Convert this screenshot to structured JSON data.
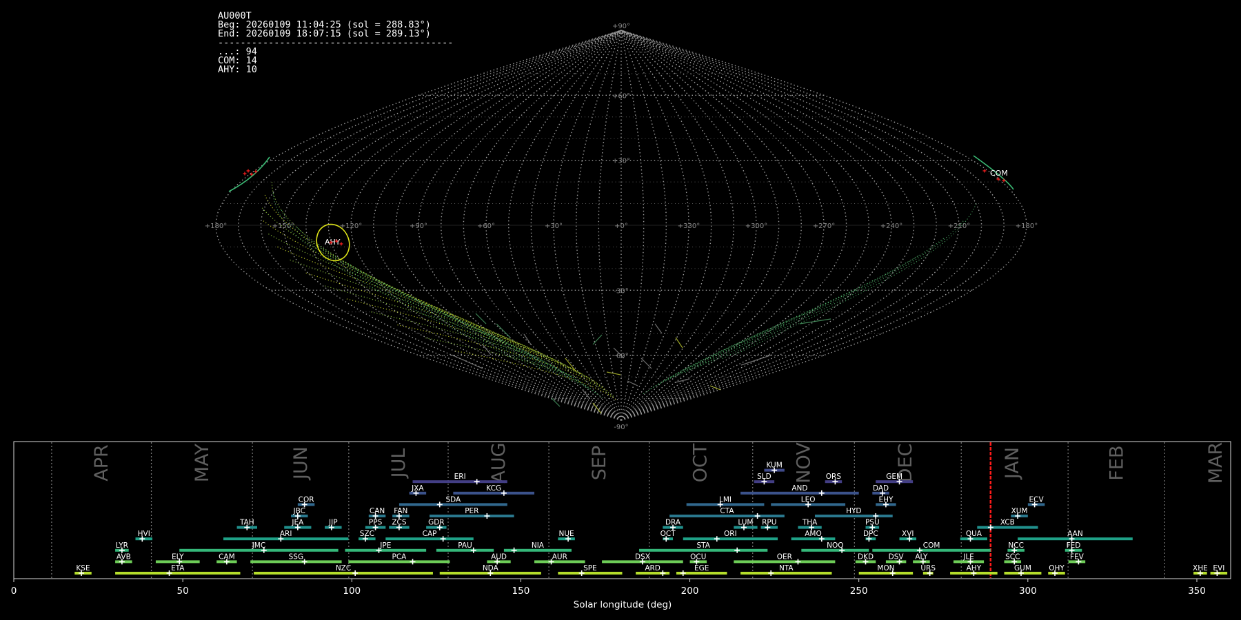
{
  "info": {
    "station": "AU000T",
    "beg": "Beg: 20260109 11:04:25 (sol = 288.83°)",
    "end": "End: 20260109 18:07:15 (sol = 289.13°)",
    "separator": "------------------------------------------",
    "counts": [
      "...: 94",
      "COM: 14",
      "AHY: 10"
    ]
  },
  "sky": {
    "lat_labels": [
      "+90°",
      "+60°",
      "+30°",
      "-30°",
      "-60°",
      "-90°"
    ],
    "lon_labels": [
      "+180°",
      "+150°",
      "+120°",
      "+90°",
      "+60°",
      "+30°",
      "+0°",
      "+330°",
      "+300°",
      "+270°",
      "+240°",
      "+210°",
      "+180°"
    ],
    "radiants": [
      {
        "code": "AHY",
        "color": "#dde318"
      },
      {
        "code": "COM",
        "color": "#3bbb75"
      }
    ]
  },
  "chart_data": {
    "type": "bar",
    "xlabel": "Solar longitude (deg)",
    "xlim": [
      0,
      360
    ],
    "xticks": [
      0,
      50,
      100,
      150,
      200,
      250,
      300,
      350
    ],
    "current_sol": 288.98,
    "months": [
      {
        "label": "APR",
        "start": 11.2
      },
      {
        "label": "MAY",
        "start": 40.7
      },
      {
        "label": "JUN",
        "start": 70.6
      },
      {
        "label": "JUL",
        "start": 99.1
      },
      {
        "label": "AUG",
        "start": 128.5
      },
      {
        "label": "SEP",
        "start": 158.3
      },
      {
        "label": "OCT",
        "start": 188.0
      },
      {
        "label": "NOV",
        "start": 218.6
      },
      {
        "label": "DEC",
        "start": 248.7
      },
      {
        "label": "JAN",
        "start": 280.3
      },
      {
        "label": "FEB",
        "start": 311.9
      },
      {
        "label": "MAR",
        "start": 340.5
      }
    ],
    "showers": [
      {
        "code": "KUM",
        "start": 222,
        "end": 228,
        "peak": 225,
        "row": 8,
        "color": "#3f4a8a"
      },
      {
        "code": "ERI",
        "start": 118,
        "end": 146,
        "peak": 137,
        "row": 7,
        "color": "#433e85"
      },
      {
        "code": "SLD",
        "start": 219,
        "end": 225,
        "peak": 222,
        "row": 7,
        "color": "#433e85"
      },
      {
        "code": "ORS",
        "start": 240,
        "end": 245,
        "peak": 243,
        "row": 7,
        "color": "#433e85"
      },
      {
        "code": "GEM",
        "start": 255,
        "end": 266,
        "peak": 262,
        "row": 7,
        "color": "#433e85"
      },
      {
        "code": "JXA",
        "start": 117,
        "end": 122,
        "peak": 119,
        "row": 6,
        "color": "#3b528b"
      },
      {
        "code": "KCG",
        "start": 130,
        "end": 154,
        "peak": 145,
        "row": 6,
        "color": "#3b528b"
      },
      {
        "code": "AND",
        "start": 215,
        "end": 250,
        "peak": 239,
        "row": 6,
        "color": "#3b528b"
      },
      {
        "code": "DAD",
        "start": 254,
        "end": 259,
        "peak": 257,
        "row": 6,
        "color": "#3b528b"
      },
      {
        "code": "COR",
        "start": 84,
        "end": 89,
        "peak": 86,
        "row": 5,
        "color": "#31688e"
      },
      {
        "code": "SDA",
        "start": 114,
        "end": 146,
        "peak": 126,
        "row": 5,
        "color": "#31688e"
      },
      {
        "code": "LMI",
        "start": 199,
        "end": 222,
        "peak": 209,
        "row": 5,
        "color": "#31688e"
      },
      {
        "code": "LEO",
        "start": 224,
        "end": 246,
        "peak": 235,
        "row": 5,
        "color": "#31688e"
      },
      {
        "code": "EHY",
        "start": 255,
        "end": 261,
        "peak": 258,
        "row": 5,
        "color": "#31688e"
      },
      {
        "code": "ECV",
        "start": 300,
        "end": 305,
        "peak": 302,
        "row": 5,
        "color": "#31688e"
      },
      {
        "code": "JBC",
        "start": 82,
        "end": 87,
        "peak": 84,
        "row": 4,
        "color": "#2a788e"
      },
      {
        "code": "CAN",
        "start": 105,
        "end": 110,
        "peak": 107,
        "row": 4,
        "color": "#2a788e"
      },
      {
        "code": "FAN",
        "start": 112,
        "end": 117,
        "peak": 114,
        "row": 4,
        "color": "#2a788e"
      },
      {
        "code": "PER",
        "start": 123,
        "end": 148,
        "peak": 140,
        "row": 4,
        "color": "#2a788e"
      },
      {
        "code": "CTA",
        "start": 194,
        "end": 228,
        "peak": 220,
        "row": 4,
        "color": "#2a788e"
      },
      {
        "code": "HYD",
        "start": 237,
        "end": 260,
        "peak": 255,
        "row": 4,
        "color": "#2a788e"
      },
      {
        "code": "XUM",
        "start": 295,
        "end": 300,
        "peak": 297,
        "row": 4,
        "color": "#2a788e"
      },
      {
        "code": "TAH",
        "start": 66,
        "end": 72,
        "peak": 69,
        "row": 3,
        "color": "#21908d"
      },
      {
        "code": "JEA",
        "start": 80,
        "end": 88,
        "peak": 84,
        "row": 3,
        "color": "#21908d"
      },
      {
        "code": "JIP",
        "start": 92,
        "end": 97,
        "peak": 94,
        "row": 3,
        "color": "#21908d"
      },
      {
        "code": "PPS",
        "start": 104,
        "end": 110,
        "peak": 107,
        "row": 3,
        "color": "#21908d"
      },
      {
        "code": "ZCS",
        "start": 111,
        "end": 117,
        "peak": 114,
        "row": 3,
        "color": "#21908d"
      },
      {
        "code": "GDR",
        "start": 122,
        "end": 128,
        "peak": 126,
        "row": 3,
        "color": "#21908d"
      },
      {
        "code": "DRA",
        "start": 192,
        "end": 198,
        "peak": 195,
        "row": 3,
        "color": "#21908d"
      },
      {
        "code": "LUM",
        "start": 213,
        "end": 220,
        "peak": 216,
        "row": 3,
        "color": "#21908d"
      },
      {
        "code": "RPU",
        "start": 221,
        "end": 226,
        "peak": 223,
        "row": 3,
        "color": "#21908d"
      },
      {
        "code": "THA",
        "start": 232,
        "end": 239,
        "peak": 236,
        "row": 3,
        "color": "#21908d"
      },
      {
        "code": "PSU",
        "start": 252,
        "end": 256,
        "peak": 254,
        "row": 3,
        "color": "#21908d"
      },
      {
        "code": "XCB",
        "start": 285,
        "end": 303,
        "peak": 289,
        "row": 3,
        "color": "#21908d"
      },
      {
        "code": "HVI",
        "start": 36,
        "end": 41,
        "peak": 38,
        "row": 2,
        "color": "#1fa187"
      },
      {
        "code": "ARI",
        "start": 62,
        "end": 99,
        "peak": 79,
        "row": 2,
        "color": "#1fa187"
      },
      {
        "code": "SZC",
        "start": 102,
        "end": 107,
        "peak": 104,
        "row": 2,
        "color": "#1fa187"
      },
      {
        "code": "CAP",
        "start": 110,
        "end": 136,
        "peak": 127,
        "row": 2,
        "color": "#1fa187"
      },
      {
        "code": "NUE",
        "start": 161,
        "end": 166,
        "peak": 164,
        "row": 2,
        "color": "#1fa187"
      },
      {
        "code": "OCT",
        "start": 192,
        "end": 195,
        "peak": 193,
        "row": 2,
        "color": "#1fa187"
      },
      {
        "code": "ORI",
        "start": 198,
        "end": 226,
        "peak": 208,
        "row": 2,
        "color": "#1fa187"
      },
      {
        "code": "AMO",
        "start": 230,
        "end": 243,
        "peak": 239,
        "row": 2,
        "color": "#1fa187"
      },
      {
        "code": "DPC",
        "start": 252,
        "end": 255,
        "peak": 253,
        "row": 2,
        "color": "#1fa187"
      },
      {
        "code": "XVI",
        "start": 262,
        "end": 267,
        "peak": 265,
        "row": 2,
        "color": "#1fa187"
      },
      {
        "code": "QUA",
        "start": 280,
        "end": 288,
        "peak": 283,
        "row": 2,
        "color": "#1fa187"
      },
      {
        "code": "AAN",
        "start": 297,
        "end": 331,
        "peak": 313,
        "row": 2,
        "color": "#1fa187"
      },
      {
        "code": "LYR",
        "start": 30,
        "end": 34,
        "peak": 32,
        "row": 1,
        "color": "#35b779"
      },
      {
        "code": "JMC",
        "start": 49,
        "end": 96,
        "peak": 74,
        "row": 1,
        "color": "#35b779"
      },
      {
        "code": "JPE",
        "start": 98,
        "end": 122,
        "peak": 108,
        "row": 1,
        "color": "#35b779"
      },
      {
        "code": "PAU",
        "start": 125,
        "end": 142,
        "peak": 136,
        "row": 1,
        "color": "#35b779"
      },
      {
        "code": "NIA",
        "start": 145,
        "end": 165,
        "peak": 148,
        "row": 1,
        "color": "#35b779"
      },
      {
        "code": "STA",
        "start": 185,
        "end": 223,
        "peak": 214,
        "row": 1,
        "color": "#35b779"
      },
      {
        "code": "NOO",
        "start": 233,
        "end": 253,
        "peak": 245,
        "row": 1,
        "color": "#35b779"
      },
      {
        "code": "COM",
        "start": 254,
        "end": 289,
        "peak": 268,
        "row": 1,
        "color": "#35b779"
      },
      {
        "code": "NCC",
        "start": 294,
        "end": 299,
        "peak": 296,
        "row": 1,
        "color": "#35b779"
      },
      {
        "code": "FED",
        "start": 311,
        "end": 316,
        "peak": 313,
        "row": 1,
        "color": "#35b779"
      },
      {
        "code": "AVB",
        "start": 30,
        "end": 35,
        "peak": 32,
        "row": 0,
        "color": "#6ece58"
      },
      {
        "code": "ELY",
        "start": 42,
        "end": 55,
        "peak": 49,
        "row": 0,
        "color": "#6ece58"
      },
      {
        "code": "CAM",
        "start": 60,
        "end": 66,
        "peak": 63,
        "row": 0,
        "color": "#6ece58"
      },
      {
        "code": "SSG",
        "start": 70,
        "end": 97,
        "peak": 86,
        "row": 0,
        "color": "#6ece58"
      },
      {
        "code": "PCA",
        "start": 99,
        "end": 129,
        "peak": 118,
        "row": 0,
        "color": "#6ece58"
      },
      {
        "code": "AUD",
        "start": 140,
        "end": 147,
        "peak": 143,
        "row": 0,
        "color": "#6ece58"
      },
      {
        "code": "AUR",
        "start": 154,
        "end": 169,
        "peak": 159,
        "row": 0,
        "color": "#6ece58"
      },
      {
        "code": "DSX",
        "start": 174,
        "end": 198,
        "peak": 186,
        "row": 0,
        "color": "#6ece58"
      },
      {
        "code": "OCU",
        "start": 200,
        "end": 205,
        "peak": 202,
        "row": 0,
        "color": "#6ece58"
      },
      {
        "code": "OER",
        "start": 213,
        "end": 243,
        "peak": 232,
        "row": 0,
        "color": "#6ece58"
      },
      {
        "code": "DKD",
        "start": 249,
        "end": 255,
        "peak": 252,
        "row": 0,
        "color": "#6ece58"
      },
      {
        "code": "DSV",
        "start": 258,
        "end": 264,
        "peak": 262,
        "row": 0,
        "color": "#6ece58"
      },
      {
        "code": "ALY",
        "start": 266,
        "end": 271,
        "peak": 269,
        "row": 0,
        "color": "#6ece58"
      },
      {
        "code": "JLE",
        "start": 278,
        "end": 287,
        "peak": 283,
        "row": 0,
        "color": "#6ece58"
      },
      {
        "code": "SCC",
        "start": 293,
        "end": 298,
        "peak": 296,
        "row": 0,
        "color": "#6ece58"
      },
      {
        "code": "FEV",
        "start": 312,
        "end": 317,
        "peak": 315,
        "row": 0,
        "color": "#6ece58"
      },
      {
        "code": "KSE",
        "start": 18,
        "end": 23,
        "peak": 20,
        "row": -1,
        "color": "#b5de2b"
      },
      {
        "code": "ETA",
        "start": 30,
        "end": 67,
        "peak": 46,
        "row": -1,
        "color": "#b5de2b"
      },
      {
        "code": "NZC",
        "start": 71,
        "end": 124,
        "peak": 101,
        "row": -1,
        "color": "#b5de2b"
      },
      {
        "code": "NDA",
        "start": 126,
        "end": 156,
        "peak": 141,
        "row": -1,
        "color": "#b5de2b"
      },
      {
        "code": "SPE",
        "start": 161,
        "end": 180,
        "peak": 168,
        "row": -1,
        "color": "#b5de2b"
      },
      {
        "code": "ARD",
        "start": 184,
        "end": 194,
        "peak": 192,
        "row": -1,
        "color": "#b5de2b"
      },
      {
        "code": "EGE",
        "start": 196,
        "end": 211,
        "peak": 198,
        "row": -1,
        "color": "#b5de2b"
      },
      {
        "code": "NTA",
        "start": 215,
        "end": 242,
        "peak": 224,
        "row": -1,
        "color": "#b5de2b"
      },
      {
        "code": "MON",
        "start": 250,
        "end": 266,
        "peak": 260,
        "row": -1,
        "color": "#b5de2b"
      },
      {
        "code": "URS",
        "start": 269,
        "end": 272,
        "peak": 271,
        "row": -1,
        "color": "#b5de2b"
      },
      {
        "code": "AHY",
        "start": 277,
        "end": 291,
        "peak": 284,
        "row": -1,
        "color": "#b5de2b"
      },
      {
        "code": "GUM",
        "start": 293,
        "end": 304,
        "peak": 298,
        "row": -1,
        "color": "#b5de2b"
      },
      {
        "code": "OHY",
        "start": 306,
        "end": 311,
        "peak": 308,
        "row": -1,
        "color": "#b5de2b"
      },
      {
        "code": "XHE",
        "start": 349,
        "end": 353,
        "peak": 351,
        "row": -1,
        "color": "#b5de2b"
      },
      {
        "code": "EVI",
        "start": 354,
        "end": 359,
        "peak": 356,
        "row": -1,
        "color": "#b5de2b"
      }
    ]
  }
}
